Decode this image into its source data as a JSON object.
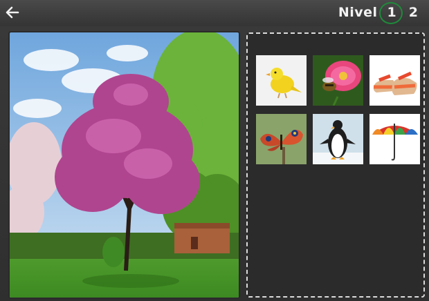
{
  "header": {
    "level_label": "Nivel",
    "levels": [
      "1",
      "2"
    ],
    "current_level": "1"
  },
  "icons": {
    "back": "back-arrow-icon"
  },
  "choices": [
    {
      "name": "canary"
    },
    {
      "name": "bee-on-flower"
    },
    {
      "name": "sandals"
    },
    {
      "name": "butterfly"
    },
    {
      "name": "penguin"
    },
    {
      "name": "umbrella"
    }
  ],
  "colors": {
    "board": "#2f2f2f",
    "selection_ring": "#1f8a3a",
    "dashed_border": "#dcdcdc"
  }
}
